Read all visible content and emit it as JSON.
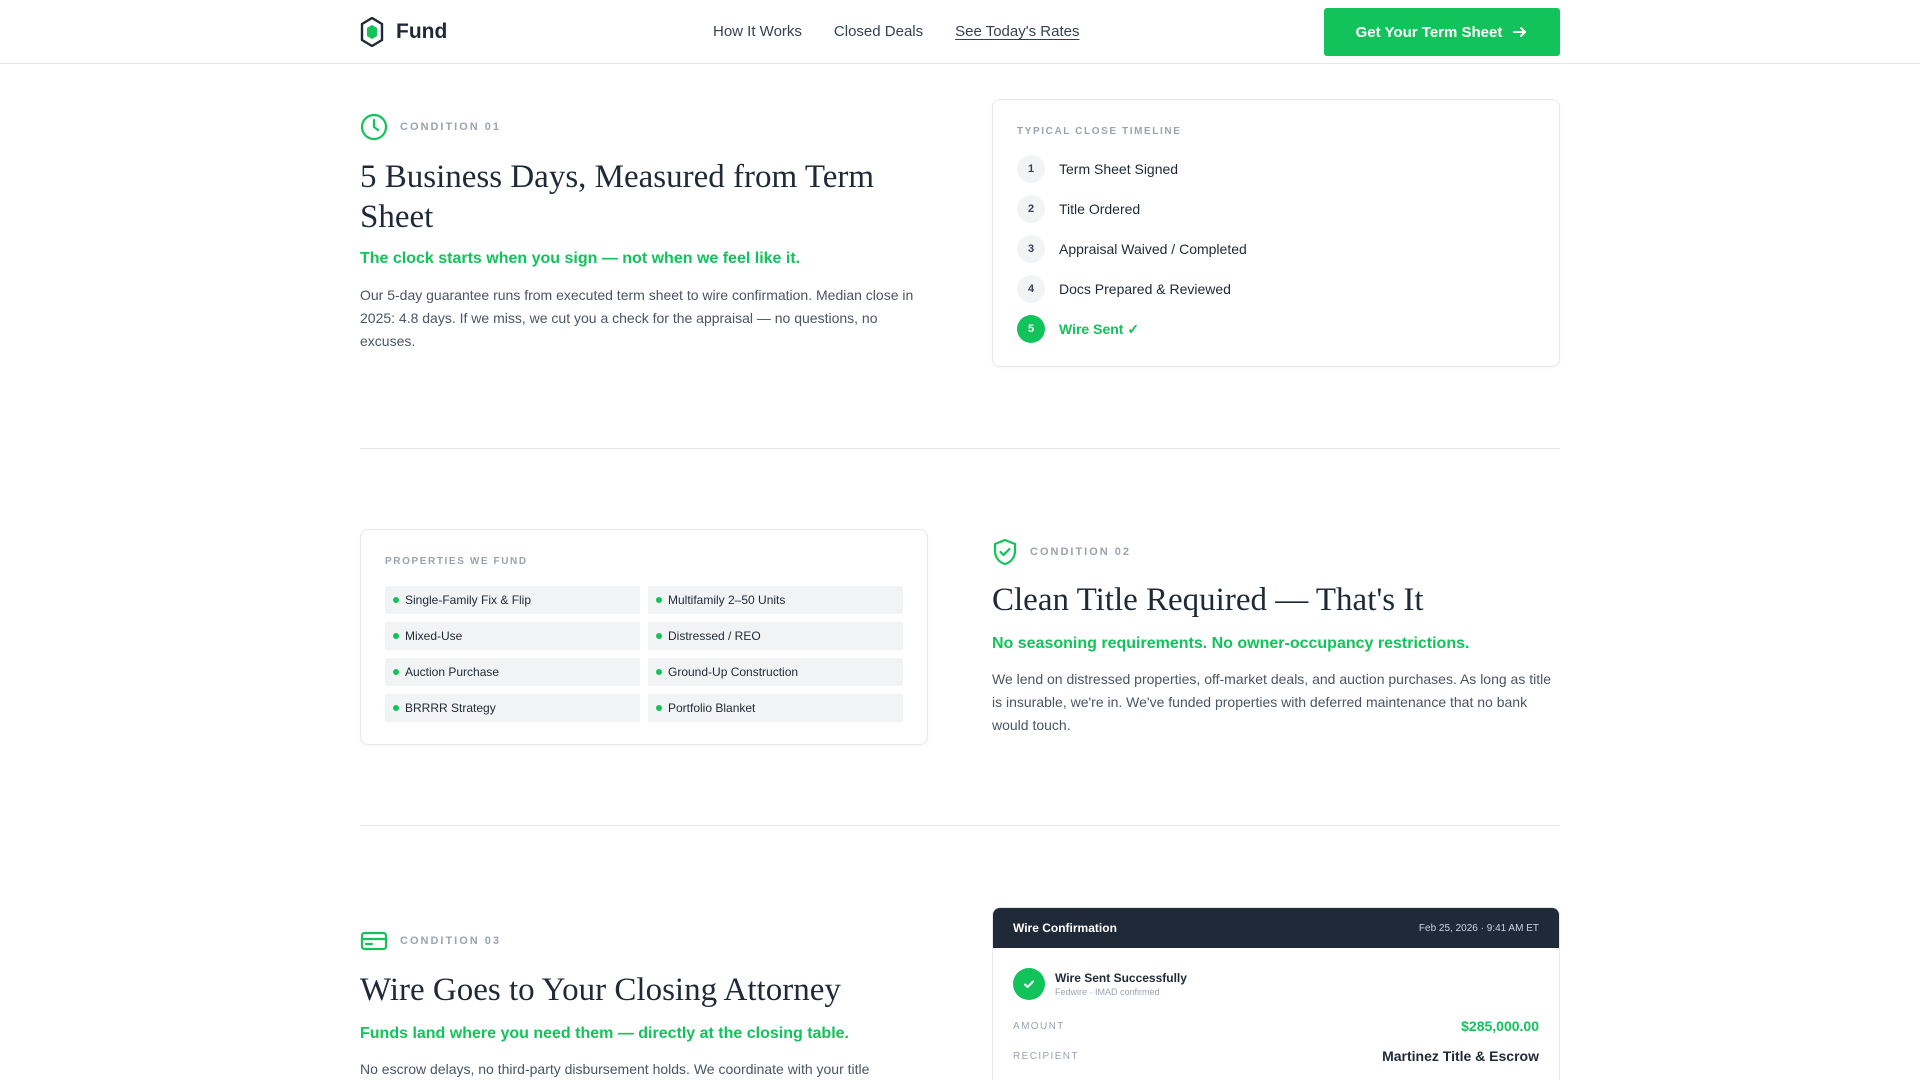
{
  "header": {
    "logo_text": "Fund",
    "nav": [
      {
        "label": "How It Works"
      },
      {
        "label": "Closed Deals"
      },
      {
        "label": "See Today's Rates"
      }
    ],
    "cta_label": "Get Your Term Sheet"
  },
  "condition1": {
    "label": "CONDITION 01",
    "title": "5 Business Days, Measured from Term Sheet",
    "subtitle": "The clock starts when you sign — not when we feel like it.",
    "body": "Our 5-day guarantee runs from executed term sheet to wire confirmation. Median close in 2025: 4.8 days. If we miss, we cut you a check for the appraisal — no questions, no excuses.",
    "timeline": {
      "label": "TYPICAL CLOSE TIMELINE",
      "steps": [
        {
          "num": "1",
          "text": "Term Sheet Signed"
        },
        {
          "num": "2",
          "text": "Title Ordered"
        },
        {
          "num": "3",
          "text": "Appraisal Waived / Completed"
        },
        {
          "num": "4",
          "text": "Docs Prepared & Reviewed"
        },
        {
          "num": "5",
          "text": "Wire Sent ✓"
        }
      ]
    }
  },
  "condition2": {
    "label": "CONDITION 02",
    "title": "Clean Title Required — That's It",
    "subtitle": "No seasoning requirements. No owner-occupancy restrictions.",
    "body": "We lend on distressed properties, off-market deals, and auction purchases. As long as title is insurable, we're in. We've funded properties with deferred maintenance that no bank would touch.",
    "properties": {
      "label": "PROPERTIES WE FUND",
      "items": [
        "Single-Family Fix & Flip",
        "Multifamily 2–50 Units",
        "Mixed-Use",
        "Distressed / REO",
        "Auction Purchase",
        "Ground-Up Construction",
        "BRRRR Strategy",
        "Portfolio Blanket"
      ]
    }
  },
  "condition3": {
    "label": "CONDITION 03",
    "title": "Wire Goes to Your Closing Attorney",
    "subtitle": "Funds land where you need them — directly at the closing table.",
    "body": "No escrow delays, no third-party disbursement holds. We coordinate with your title",
    "wire": {
      "title": "Wire Confirmation",
      "timestamp": "Feb 25, 2026 · 9:41 AM ET",
      "status_title": "Wire Sent Successfully",
      "status_sub": "Fedwire · IMAD confirmed",
      "amount_label": "AMOUNT",
      "amount": "$285,000.00",
      "recipient_label": "RECIPIENT",
      "recipient": "Martinez Title & Escrow"
    }
  },
  "colors": {
    "accent": "#11c35a",
    "dark": "#1f2937",
    "muted": "#9ca3af"
  }
}
